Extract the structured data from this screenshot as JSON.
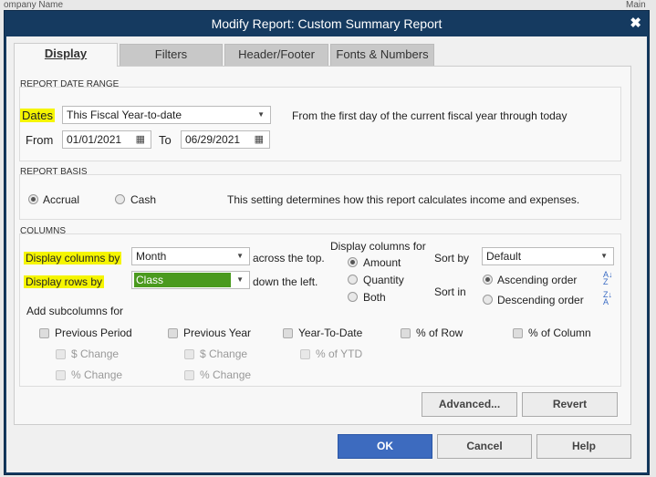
{
  "background": {
    "left_text": "ompany Name",
    "right_text": "Main Co"
  },
  "dialog": {
    "title": "Modify Report: Custom Summary Report",
    "close_icon": "close-icon"
  },
  "tabs": [
    {
      "label": "Display",
      "active": true
    },
    {
      "label": "Filters"
    },
    {
      "label": "Header/Footer"
    },
    {
      "label": "Fonts & Numbers"
    }
  ],
  "date_range": {
    "section": "REPORT DATE RANGE",
    "dates_label": "Dates",
    "dates_value": "This Fiscal Year-to-date",
    "description": "From the first day of the current fiscal year through today",
    "from_label": "From",
    "from_value": "01/01/2021",
    "to_label": "To",
    "to_value": "06/29/2021"
  },
  "basis": {
    "section": "REPORT BASIS",
    "accrual": "Accrual",
    "cash": "Cash",
    "selected": "Accrual",
    "description": "This setting determines how this report calculates income and expenses."
  },
  "columns": {
    "section": "COLUMNS",
    "display_columns_label": "Display columns by",
    "display_columns_value": "Month",
    "across": "across the top.",
    "display_rows_label": "Display rows by",
    "display_rows_value": "Class",
    "down": "down the left.",
    "display_for_label": "Display columns for",
    "display_for_options": [
      "Amount",
      "Quantity",
      "Both"
    ],
    "display_for_selected": "Amount",
    "sort_by_label": "Sort by",
    "sort_by_value": "Default",
    "sort_in_label": "Sort in",
    "ascending": "Ascending order",
    "descending": "Descending order",
    "sort_selected": "Ascending order",
    "subcolumns_label": "Add subcolumns for",
    "subcolumns": [
      "Previous Period",
      "Previous Year",
      "Year-To-Date",
      "% of Row",
      "% of Column"
    ],
    "sub_pp": [
      "$ Change",
      "% Change"
    ],
    "sub_py": [
      "$ Change",
      "% Change"
    ],
    "sub_ytd": [
      "% of YTD"
    ],
    "highlight_color": "#f5f500",
    "class_color": "#4a9a1e"
  },
  "buttons": {
    "advanced": "Advanced...",
    "revert": "Revert",
    "ok": "OK",
    "cancel": "Cancel",
    "help": "Help"
  }
}
